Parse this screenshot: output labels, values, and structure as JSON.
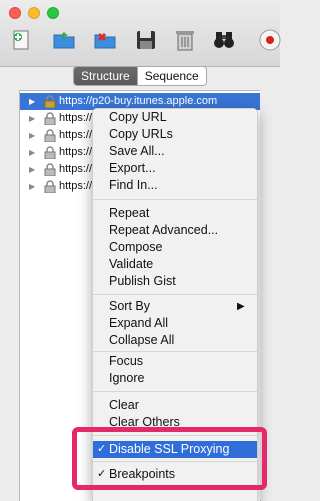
{
  "toolbar": {
    "icons": [
      "new-session-icon",
      "open-icon",
      "import-icon",
      "save-icon",
      "trash-icon",
      "binoculars-icon",
      "record-icon"
    ]
  },
  "tabs": {
    "structure": "Structure",
    "sequence": "Sequence"
  },
  "tree": {
    "rows": [
      {
        "url": "https://p20-buy.itunes.apple.com",
        "selected": true
      },
      {
        "url": "https://",
        "selected": false
      },
      {
        "url": "https://",
        "selected": false
      },
      {
        "url": "https://",
        "selected": false
      },
      {
        "url": "https://",
        "selected": false
      },
      {
        "url": "https://",
        "selected": false
      }
    ]
  },
  "menu": {
    "copy_url": "Copy URL",
    "copy_urls": "Copy URLs",
    "save_all": "Save All...",
    "export": "Export...",
    "find_in": "Find In...",
    "repeat": "Repeat",
    "repeat_advanced": "Repeat Advanced...",
    "compose": "Compose",
    "validate": "Validate",
    "publish_gist": "Publish Gist",
    "sort_by": "Sort By",
    "expand_all": "Expand All",
    "collapse_all": "Collapse All",
    "focus": "Focus",
    "ignore": "Ignore",
    "clear": "Clear",
    "clear_others": "Clear Others",
    "disable_ssl": "Disable SSL Proxying",
    "breakpoints": "Breakpoints",
    "checkmark": "✓"
  },
  "colors": {
    "accent": "#2f6ed8",
    "highlight_box": "#e5286b",
    "selected_row": "#3875d7"
  }
}
